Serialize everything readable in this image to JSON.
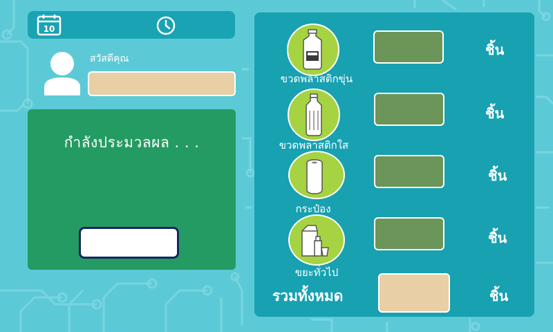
{
  "header": {
    "calendar_day": "10"
  },
  "user": {
    "greeting": "สวัสดีคุณ",
    "name_value": ""
  },
  "processing": {
    "status_text": "กำลังประมวลผล . . .",
    "button_label": ""
  },
  "items": [
    {
      "label": "ขวดพลาสติกขุ่น",
      "count": "",
      "unit": "ชิ้น",
      "icon": "milk-jug-icon"
    },
    {
      "label": "ขวดพลาสติกใส",
      "count": "",
      "unit": "ชิ้น",
      "icon": "clear-bottle-icon"
    },
    {
      "label": "กระป๋อง",
      "count": "",
      "unit": "ชิ้น",
      "icon": "can-icon"
    },
    {
      "label": "ขยะทั่วไป",
      "count": "",
      "unit": "ชิ้น",
      "icon": "general-waste-icon"
    }
  ],
  "total": {
    "label": "รวมทั้งหมด",
    "count": "",
    "unit": "ชิ้น"
  },
  "colors": {
    "background": "#5ccad6",
    "panel_teal": "#17a1b1",
    "processing_green": "#249b62",
    "count_box_green": "#6b9559",
    "icon_circle_green": "#a6d341",
    "field_beige": "#e8cfa5",
    "button_border_navy": "#12275e"
  }
}
